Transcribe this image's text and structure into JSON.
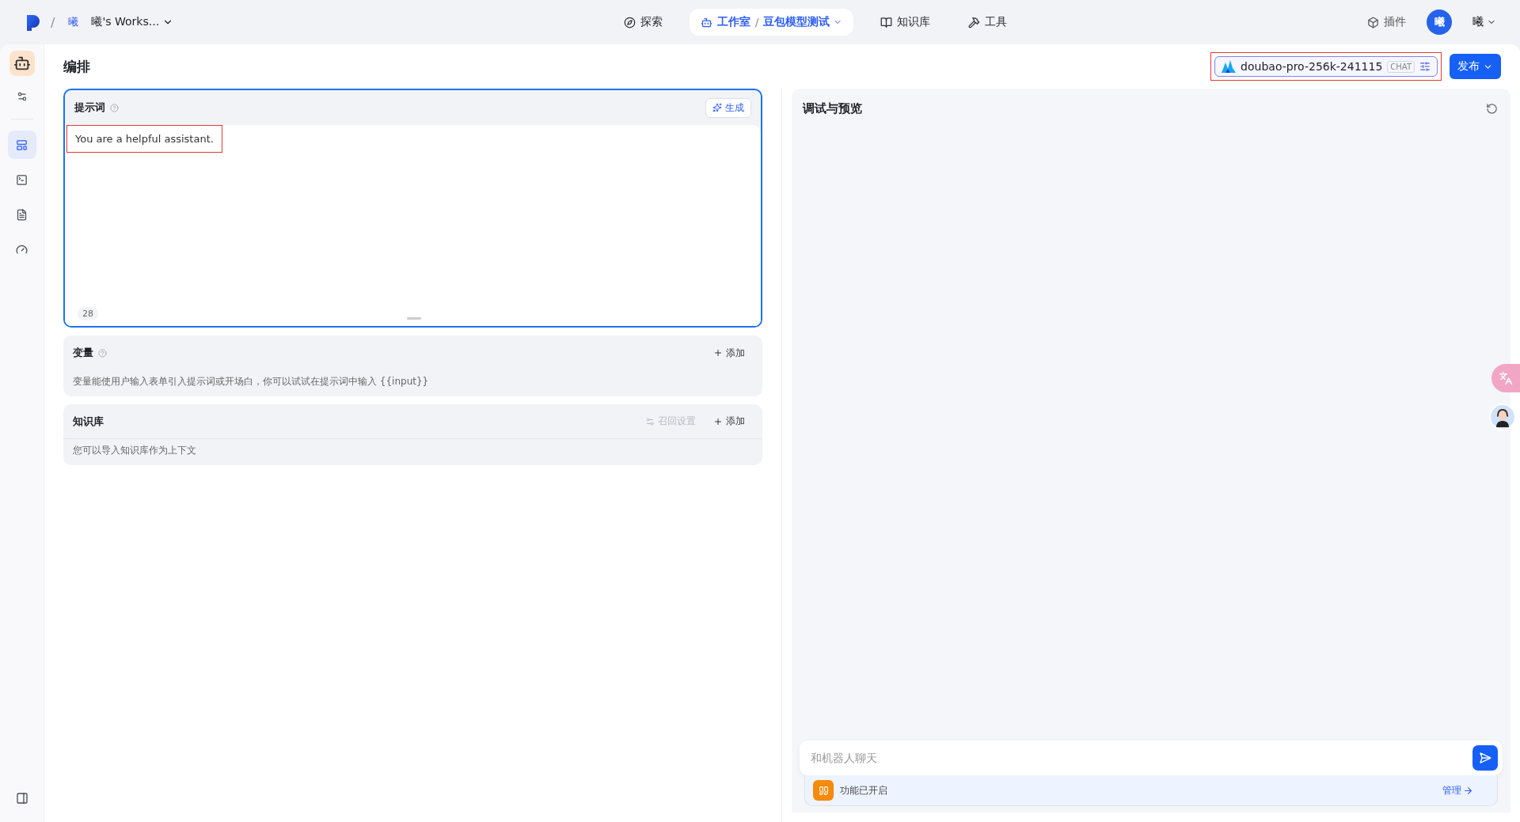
{
  "topbar": {
    "separator": "/",
    "workspace_badge": "曦",
    "workspace": "曦's Works...",
    "nav": [
      {
        "label": "探索",
        "selected": false,
        "kind": "plain"
      },
      {
        "label": "工作室",
        "selected": true,
        "kind": "crumb",
        "separator": "/",
        "crumb": "豆包模型测试"
      },
      {
        "label": "知识库",
        "selected": false,
        "kind": "plain"
      },
      {
        "label": "工具",
        "selected": false,
        "kind": "plain"
      }
    ],
    "plugin": "插件",
    "user_avatar": "曦",
    "user_name": "曦"
  },
  "sidebar": {
    "items": [
      {
        "selected": true
      },
      {
        "selected": false
      },
      {
        "selected": false
      },
      {
        "selected": false
      }
    ]
  },
  "editor": {
    "title": "编排",
    "model": {
      "name": "doubao-pro-256k-241115",
      "tag": "CHAT",
      "highlighted": true
    },
    "publish": "发布",
    "prompt": {
      "title": "提示词",
      "generate": "生成",
      "text": "You are a helpful assistant.",
      "text_highlighted": true,
      "count": "28"
    },
    "variables": {
      "title": "变量",
      "add": "添加",
      "hint": "变量能使用户输入表单引入提示词或开场白，你可以试试在提示词中输入 {{input}}"
    },
    "knowledge": {
      "title": "知识库",
      "recall": "召回设置",
      "add": "添加",
      "hint": "您可以导入知识库作为上下文"
    }
  },
  "preview": {
    "title": "调试与预览",
    "input_placeholder": "和机器人聊天",
    "feature": "功能已开启",
    "manage": "管理"
  }
}
